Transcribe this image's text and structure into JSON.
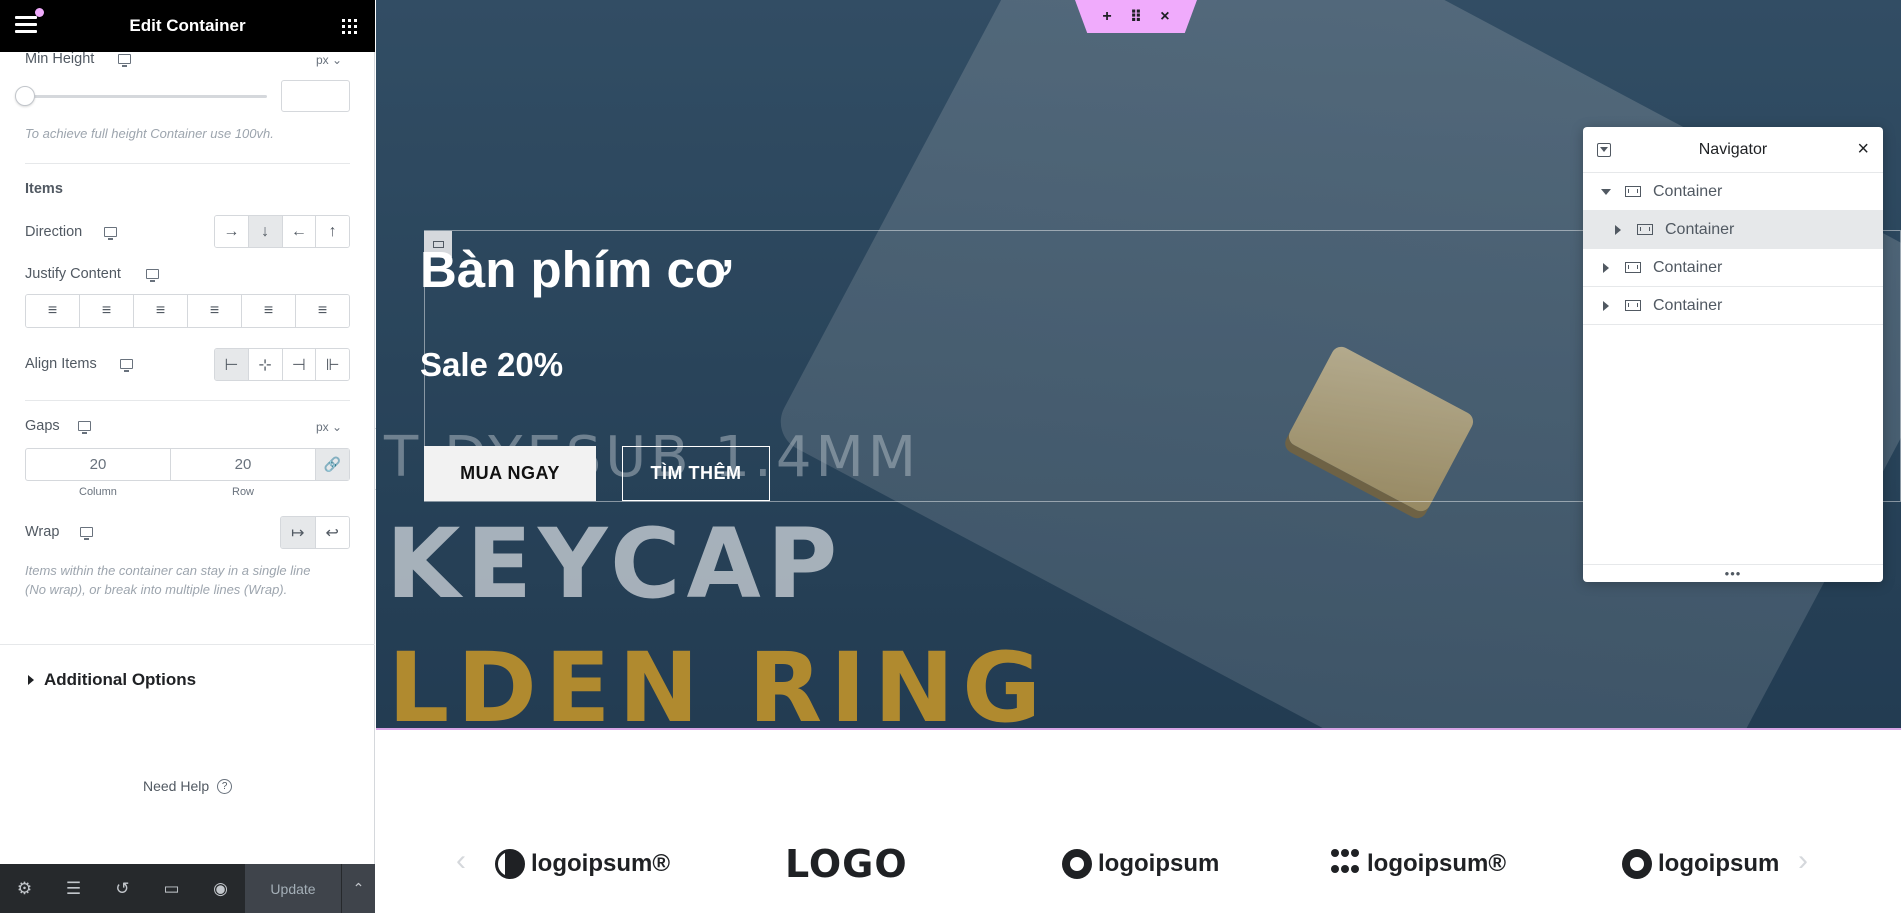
{
  "panel": {
    "title": "Edit Container",
    "min_height": {
      "label": "Min Height",
      "unit": "px ⌄",
      "value": "",
      "note": "To achieve full height Container use 100vh."
    },
    "items_section": "Items",
    "direction": {
      "label": "Direction",
      "options": [
        "→",
        "↓",
        "←",
        "↑"
      ],
      "active_index": 1
    },
    "justify_content": {
      "label": "Justify Content",
      "options": [
        "≡",
        "≡",
        "≡",
        "≡",
        "≡",
        "≡"
      ]
    },
    "align_items": {
      "label": "Align Items",
      "options": [
        "⊢",
        "⊹",
        "⊣",
        "⊩"
      ],
      "active_index": 0
    },
    "gaps": {
      "label": "Gaps",
      "unit": "px ⌄",
      "column_value": "20",
      "row_value": "20",
      "column_label": "Column",
      "row_label": "Row",
      "link_icon": "🔗"
    },
    "wrap": {
      "label": "Wrap",
      "options": [
        "↦",
        "↩"
      ],
      "active_index": 0,
      "note_line1": "Items within the container can stay in a single line",
      "note_line2": "(No wrap), or break into multiple lines (Wrap)."
    },
    "additional_options": "Additional Options",
    "need_help": "Need Help",
    "help_icon": "?",
    "footer": {
      "icons": [
        "⚙",
        "☰",
        "↺",
        "▭",
        "◉"
      ],
      "update_label": "Update",
      "up_icon": "⌃"
    },
    "collapse_icon": "‹"
  },
  "hero": {
    "title": "Bàn phím cơ",
    "sale": "Sale 20%",
    "buy_button": "MUA NGAY",
    "more_button": "TÌM THÊM",
    "bg_text_dyesub": "T DYESUB 1.4MM",
    "bg_text_keycap": "KEYCAP",
    "bg_text_ring": "LDEN RING"
  },
  "element_toolbar": {
    "add": "+",
    "move": "⠿",
    "close": "×"
  },
  "navigator": {
    "title": "Navigator",
    "close_icon": "×",
    "items": [
      {
        "label": "Container",
        "expanded": true,
        "level": 0
      },
      {
        "label": "Container",
        "expanded": false,
        "level": 1,
        "selected": true
      },
      {
        "label": "Container",
        "expanded": false,
        "level": 0
      },
      {
        "label": "Container",
        "expanded": false,
        "level": 0
      }
    ],
    "footer_icon": "•••"
  },
  "logos": {
    "items": [
      "logoipsum®",
      "LOGO",
      "logoipsum",
      "logoipsum®",
      "logoipsum"
    ],
    "prev_arrow": "‹",
    "next_arrow": "›"
  },
  "colors": {
    "accent_pink": "#f0abfc",
    "panel_header": "#000000",
    "footer_bg": "#26292c"
  }
}
